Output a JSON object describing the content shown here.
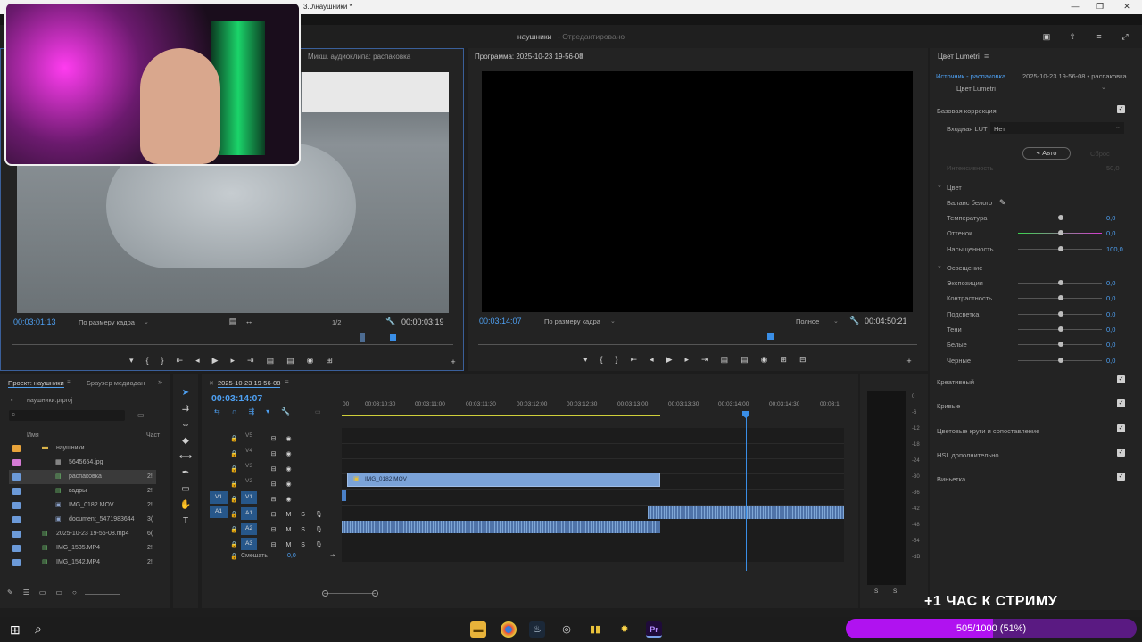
{
  "window": {
    "title_fragment": "3.0\\наушники *"
  },
  "app": {
    "project_title": "наушники",
    "status": "- Отредактировано"
  },
  "source_monitor": {
    "header": "Микш. аудиоклипа: распаковка",
    "timecode": "00:03:01:13",
    "fit": "По размеру кадра",
    "resolution": "1/2",
    "duration": "00:00:03:19"
  },
  "program_monitor": {
    "header": "Программа: 2025-10-23 19-56-08",
    "timecode": "00:03:14:07",
    "fit": "По размеру кадра",
    "quality": "Полное",
    "duration": "00:04:50:21"
  },
  "lumetri": {
    "header": "Цвет Lumetri",
    "source": "Источник - распаковка",
    "sequence": "2025-10-23 19-56-08 • распаковка",
    "effect": "Цвет Lumetri",
    "basic": "Базовая коррекция",
    "input_lut_label": "Входная LUT",
    "input_lut_value": "Нет",
    "auto": "Авто",
    "reset": "Сброс",
    "intensity_label": "Интенсивность",
    "intensity_value": "50,0",
    "color_section": "Цвет",
    "white_balance": "Баланс белого",
    "temperature": "Температура",
    "temperature_val": "0,0",
    "tint": "Оттенок",
    "tint_val": "0,0",
    "saturation": "Насыщенность",
    "saturation_val": "100,0",
    "light_section": "Освещение",
    "exposure": "Экспозиция",
    "exposure_val": "0,0",
    "contrast": "Контрастность",
    "contrast_val": "0,0",
    "highlights": "Подсветка",
    "highlights_val": "0,0",
    "shadows": "Тени",
    "shadows_val": "0,0",
    "whites": "Белые",
    "whites_val": "0,0",
    "blacks": "Черные",
    "blacks_val": "0,0",
    "creative": "Креативный",
    "curves": "Кривые",
    "wheels": "Цветовые круги и сопоставление",
    "hsl": "HSL дополнительно",
    "vignette": "Виньетка"
  },
  "project": {
    "tab1": "Проект: наушники",
    "tab2": "Браузер медиадан",
    "file": "наушники.prproj",
    "col_name": "Имя",
    "col_rate": "Част",
    "items": [
      {
        "name": "наушники",
        "rate": ""
      },
      {
        "name": "5645654.jpg",
        "rate": ""
      },
      {
        "name": "распаковка",
        "rate": "2!"
      },
      {
        "name": "кадры",
        "rate": "2!"
      },
      {
        "name": "IMG_0182.MOV",
        "rate": "2!"
      },
      {
        "name": "document_5471983644",
        "rate": "3("
      },
      {
        "name": "2025-10-23 19-56-08.mp4",
        "rate": "6("
      },
      {
        "name": "IMG_1535.MP4",
        "rate": "2!"
      },
      {
        "name": "IMG_1542.MP4",
        "rate": "2!"
      }
    ]
  },
  "timeline": {
    "tab": "2025-10-23 19-56-08",
    "timecode": "00:03:14:07",
    "ruler": [
      "00",
      "00:03:10:30",
      "00:03:11:00",
      "00:03:11:30",
      "00:03:12:00",
      "00:03:12:30",
      "00:03:13:00",
      "00:03:13:30",
      "00:03:14:00",
      "00:03:14:30",
      "00:03:1!"
    ],
    "video_tracks": [
      "V5",
      "V4",
      "V3",
      "V2",
      "V1"
    ],
    "audio_tracks": [
      "A1",
      "A2",
      "A3"
    ],
    "clip": "IMG_0182.MOV",
    "mix_label": "Смешать",
    "mix_value": "0,0",
    "v1_src": "V1",
    "a1_src": "A1",
    "m": "M",
    "s": "S"
  },
  "meter": {
    "ticks": [
      "0",
      "-6",
      "-12",
      "-18",
      "-24",
      "-30",
      "-36",
      "-42",
      "-48",
      "-54",
      "-dB"
    ],
    "s": "S"
  },
  "overlay": {
    "stream_text": "+1 ЧАС К СТРИМУ",
    "progress_text": "505/1000 (51%)",
    "progress_fraction": 0.505
  },
  "colors": {
    "accent_blue": "#4ea0f2",
    "clip_blue": "#7ba3d8",
    "progress_purple": "#b012f0"
  }
}
